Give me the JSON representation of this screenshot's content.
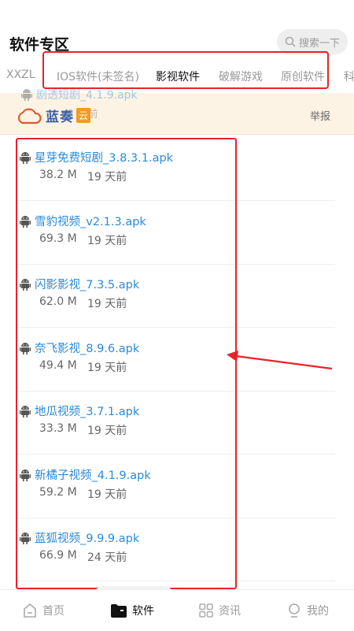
{
  "header": {
    "title": "软件专区",
    "search_placeholder": "搜索一下"
  },
  "tabs": [
    {
      "label": "XXZL"
    },
    {
      "label": "IOS软件(未签名)"
    },
    {
      "label": "影视软件"
    },
    {
      "label": "破解游戏"
    },
    {
      "label": "原创软件"
    },
    {
      "label": "科"
    }
  ],
  "banner": {
    "logo_text": "蓝奏",
    "logo_badge": "云",
    "report": "举报",
    "faded_name": "剧透短剧_4.1.9.apk",
    "faded_meta": "2 天前"
  },
  "files": [
    {
      "name": "星芽免费短剧_3.8.3.1.apk",
      "size": "38.2 M",
      "time": "19 天前"
    },
    {
      "name": "雪豹视频_v2.1.3.apk",
      "size": "69.3 M",
      "time": "19 天前"
    },
    {
      "name": "闪影影视_7.3.5.apk",
      "size": "62.0 M",
      "time": "19 天前"
    },
    {
      "name": "奈飞影视_8.9.6.apk",
      "size": "49.4 M",
      "time": "19 天前"
    },
    {
      "name": "地瓜视频_3.7.1.apk",
      "size": "33.3 M",
      "time": "19 天前"
    },
    {
      "name": "新橘子视频_4.1.9.apk",
      "size": "59.2 M",
      "time": "19 天前"
    },
    {
      "name": "蓝狐视频_9.9.9.apk",
      "size": "66.9 M",
      "time": "24 天前"
    }
  ],
  "nav": {
    "home": "首页",
    "software": "软件",
    "news": "资讯",
    "mine": "我的"
  },
  "colors": {
    "link": "#2b8ad8",
    "annotation": "#e8222a",
    "banner_bg": "#fcf3e4"
  }
}
